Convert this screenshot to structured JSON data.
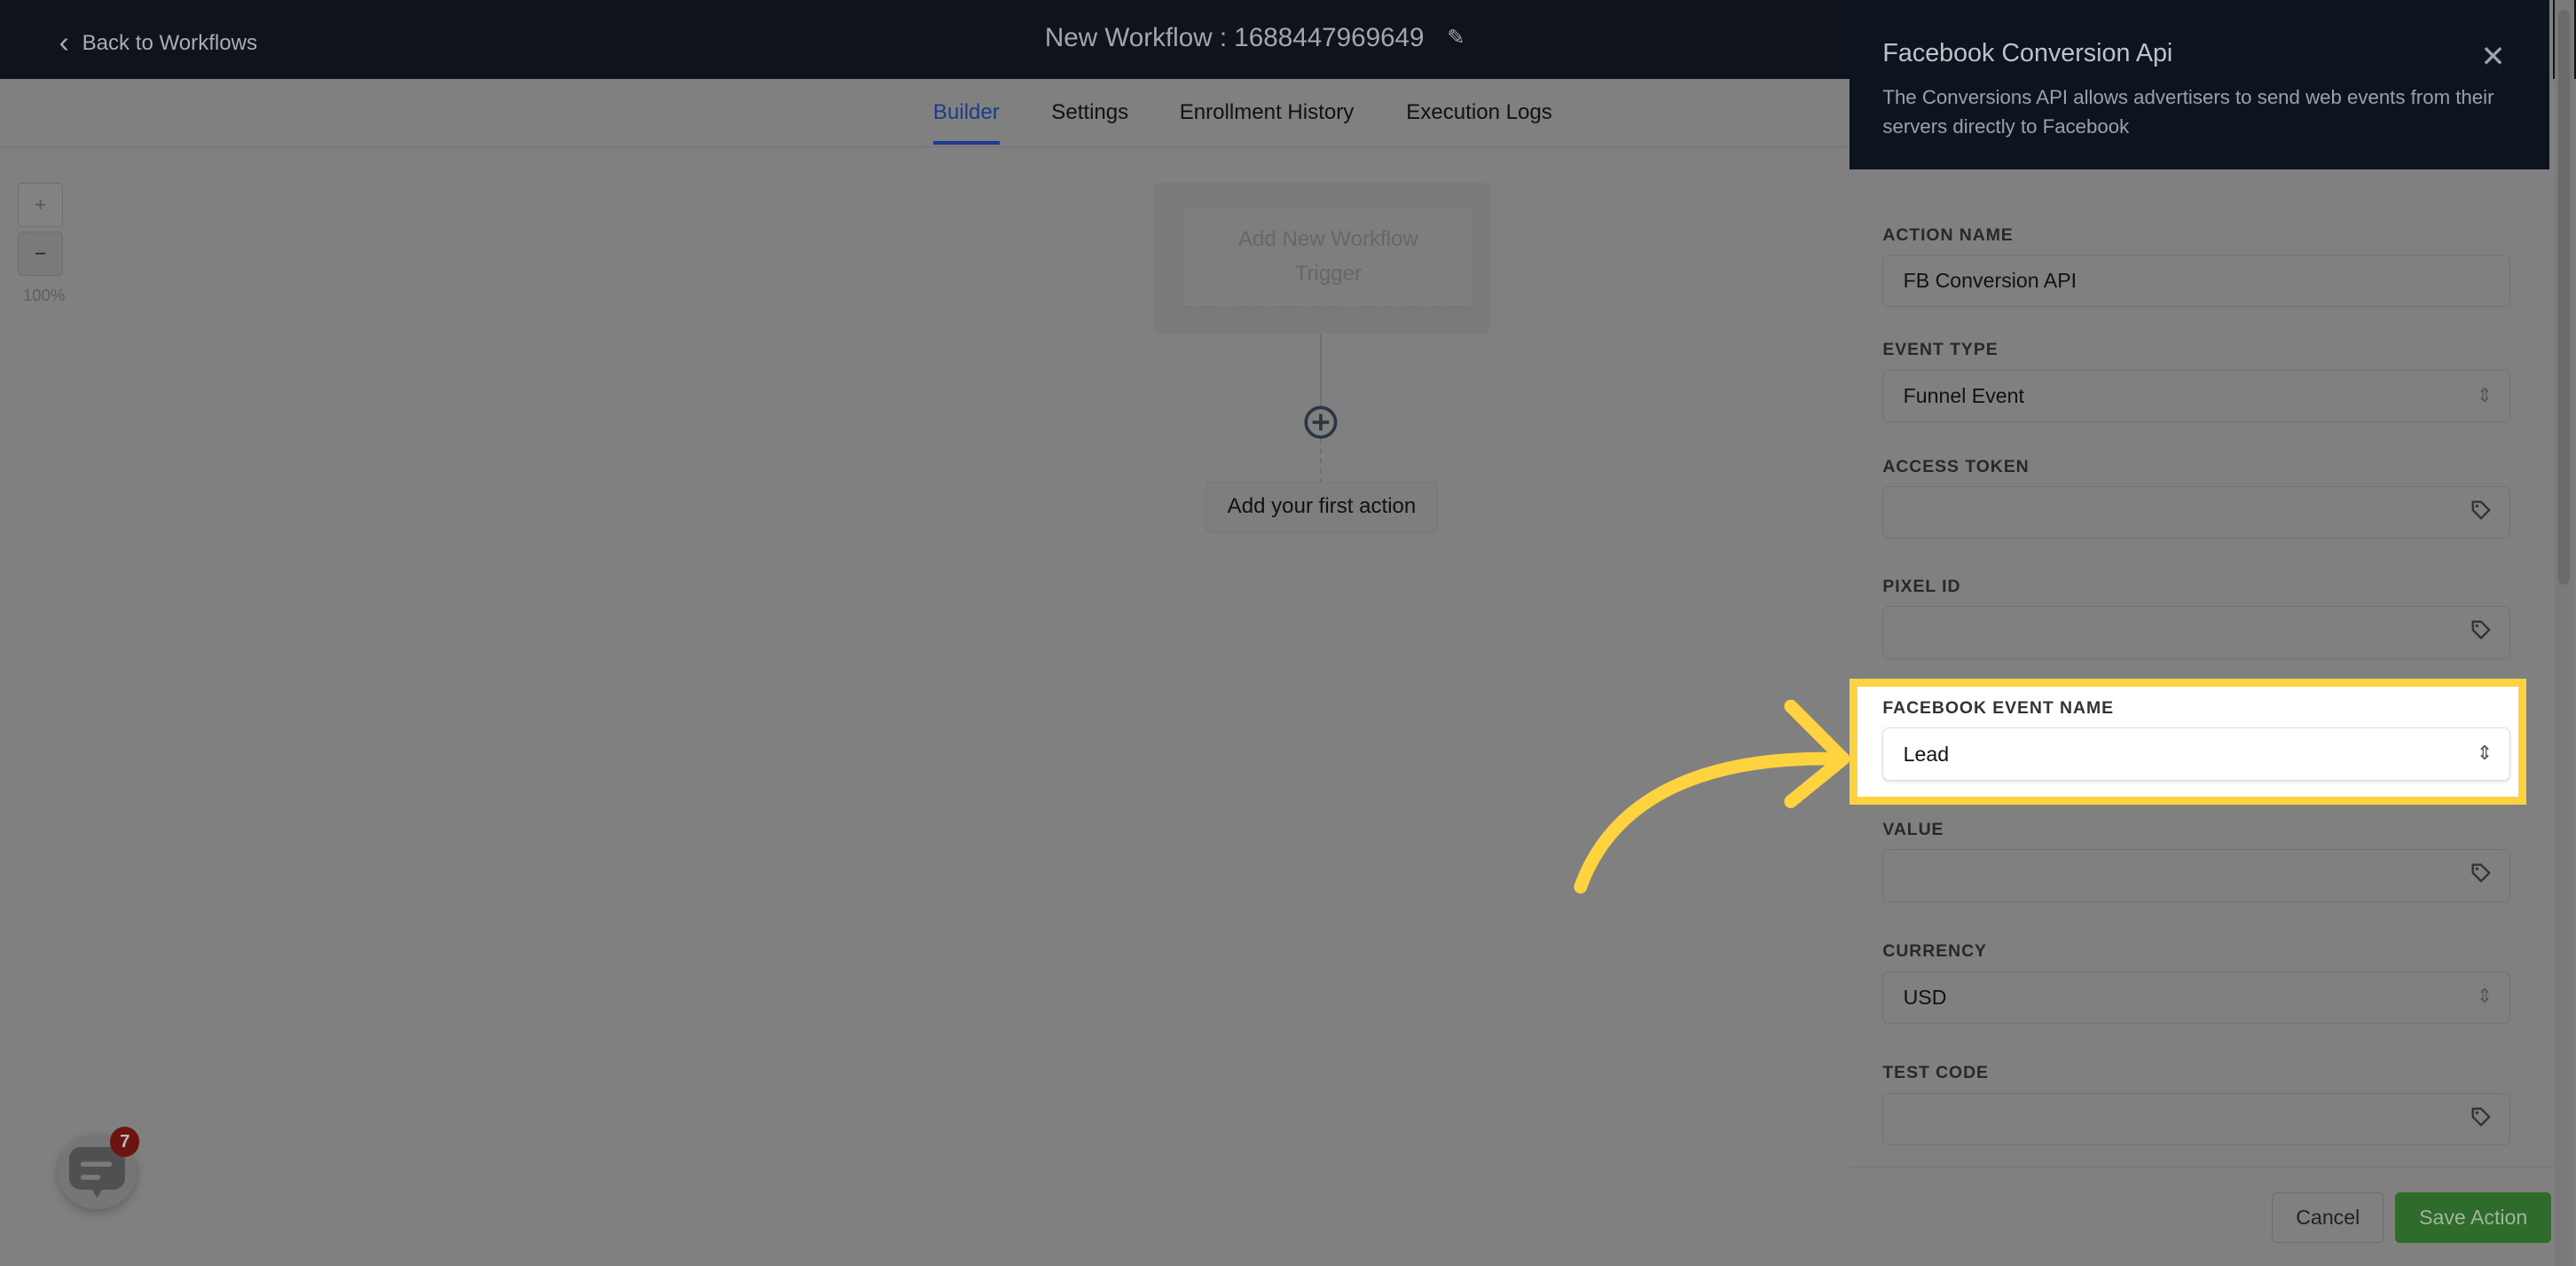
{
  "header": {
    "back_label": "Back to Workflows",
    "title": "New Workflow : 1688447969649"
  },
  "tabs": [
    {
      "label": "Builder",
      "active": true
    },
    {
      "label": "Settings"
    },
    {
      "label": "Enrollment History"
    },
    {
      "label": "Execution Logs"
    }
  ],
  "zoom": {
    "plus": "+",
    "minus": "−",
    "level": "100%"
  },
  "canvas": {
    "trigger_label": "Add New Workflow Trigger",
    "first_action_label": "Add your first action"
  },
  "panel": {
    "title": "Facebook Conversion Api",
    "description": "The Conversions API allows advertisers to send web events from their servers directly to Facebook",
    "fields": [
      {
        "label": "ACTION NAME",
        "value": "FB Conversion API",
        "type": "text"
      },
      {
        "label": "EVENT TYPE",
        "value": "Funnel Event",
        "type": "select"
      },
      {
        "label": "ACCESS TOKEN",
        "value": "",
        "type": "tag"
      },
      {
        "label": "PIXEL ID",
        "value": "",
        "type": "tag"
      },
      {
        "label": "FACEBOOK EVENT NAME",
        "value": "Lead",
        "type": "select",
        "highlighted": true
      },
      {
        "label": "VALUE",
        "value": "",
        "type": "tag"
      },
      {
        "label": "CURRENCY",
        "value": "USD",
        "type": "select"
      },
      {
        "label": "TEST CODE",
        "value": "",
        "type": "tag"
      }
    ],
    "cancel_label": "Cancel",
    "save_label": "Save Action"
  },
  "chat": {
    "badge_count": "7"
  },
  "colors": {
    "accent": "#1c3a8e",
    "highlight": "#ffd23f",
    "save": "#2f6b2a",
    "badge": "#6b1410"
  }
}
